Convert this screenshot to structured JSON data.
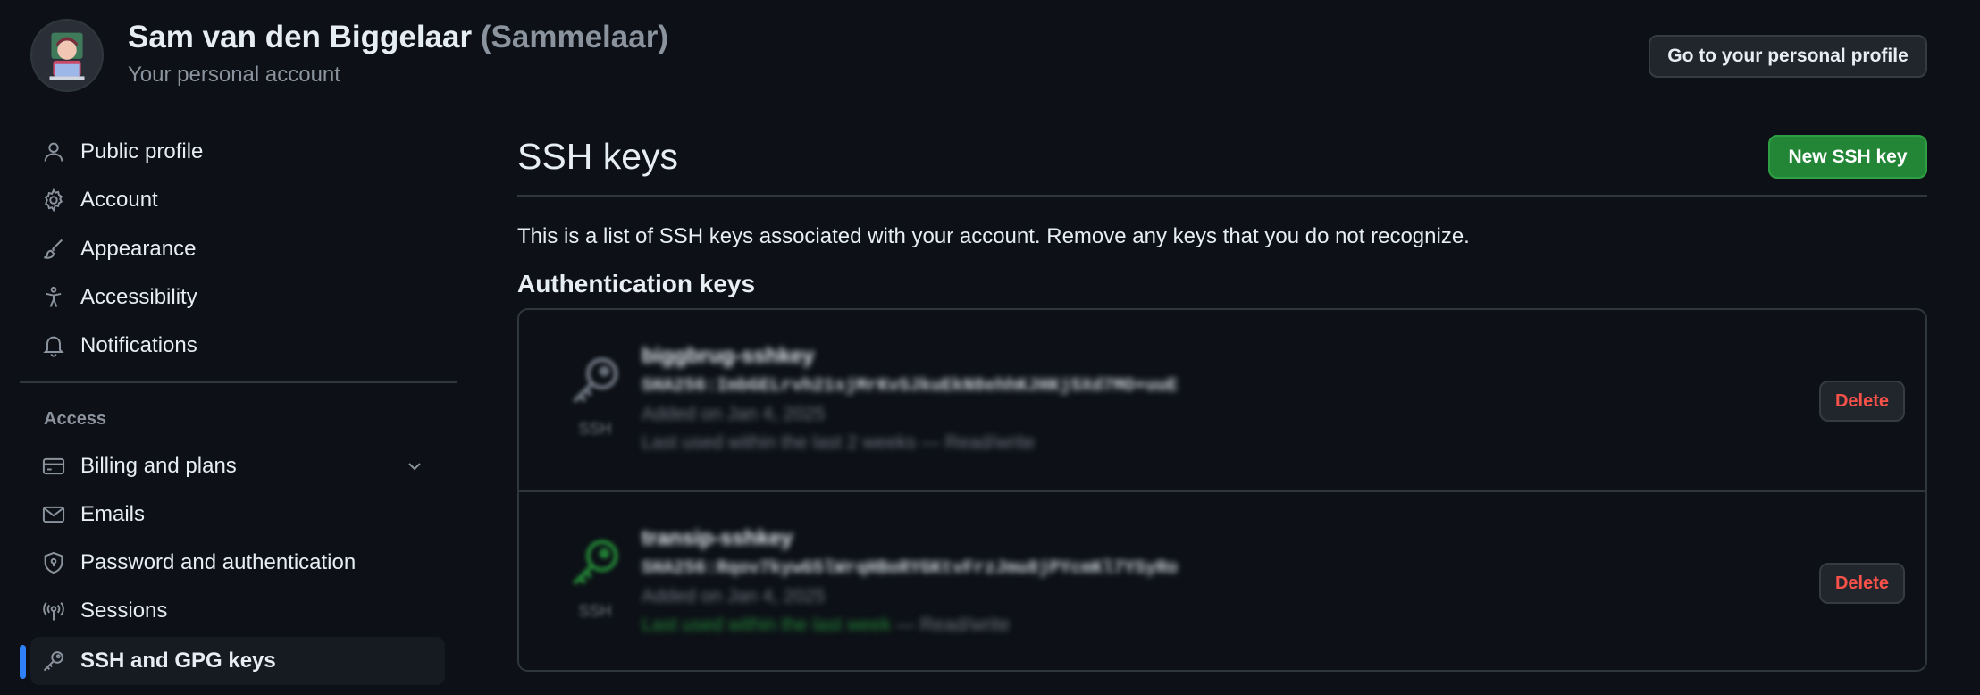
{
  "header": {
    "display_name": "Sam van den Biggelaar",
    "handle": "(Sammelaar)",
    "subtitle": "Your personal account",
    "profile_button": "Go to your personal profile"
  },
  "sidebar": {
    "items": [
      {
        "label": "Public profile",
        "icon": "person-icon"
      },
      {
        "label": "Account",
        "icon": "gear-icon"
      },
      {
        "label": "Appearance",
        "icon": "paintbrush-icon"
      },
      {
        "label": "Accessibility",
        "icon": "accessibility-icon"
      },
      {
        "label": "Notifications",
        "icon": "bell-icon"
      }
    ],
    "access_heading": "Access",
    "access_items": [
      {
        "label": "Billing and plans",
        "icon": "credit-card-icon"
      },
      {
        "label": "Emails",
        "icon": "mail-icon"
      },
      {
        "label": "Password and authentication",
        "icon": "shield-lock-icon"
      },
      {
        "label": "Sessions",
        "icon": "broadcast-icon"
      },
      {
        "label": "SSH and GPG keys",
        "icon": "key-icon"
      }
    ],
    "active_item": "SSH and GPG keys"
  },
  "main": {
    "title": "SSH keys",
    "new_button": "New SSH key",
    "description": "This is a list of SSH keys associated with your account. Remove any keys that you do not recognize.",
    "auth_heading": "Authentication keys",
    "keys": [
      {
        "title": "biggbrug-sshkey",
        "fingerprint": "SHA256:ImbGELrvh21sjMrKvSJkuEkN8ehhKJHKj5Xd7MO+uuE",
        "added": "Added on Jan 4, 2025",
        "used_recent": "",
        "used_text": "Last used within the last 2 weeks — Read/write",
        "type": "SSH",
        "icon_color": "#6e7681",
        "delete_label": "Delete"
      },
      {
        "title": "transip-sshkey",
        "fingerprint": "SHA256:Rqov7kywG5lWrqHBoRYGKtvFrzJmu8jPYcmKl7YSyRo",
        "added": "Added on Jan 4, 2025",
        "used_recent": "Last used within the last week",
        "used_text": " — Read/write",
        "type": "SSH",
        "icon_color": "#238636",
        "delete_label": "Delete"
      }
    ]
  },
  "colors": {
    "background": "#0d1117",
    "accent_blue": "#2f81f7",
    "primary_green": "#238636",
    "danger_red": "#f85149",
    "muted": "#8b949e"
  }
}
